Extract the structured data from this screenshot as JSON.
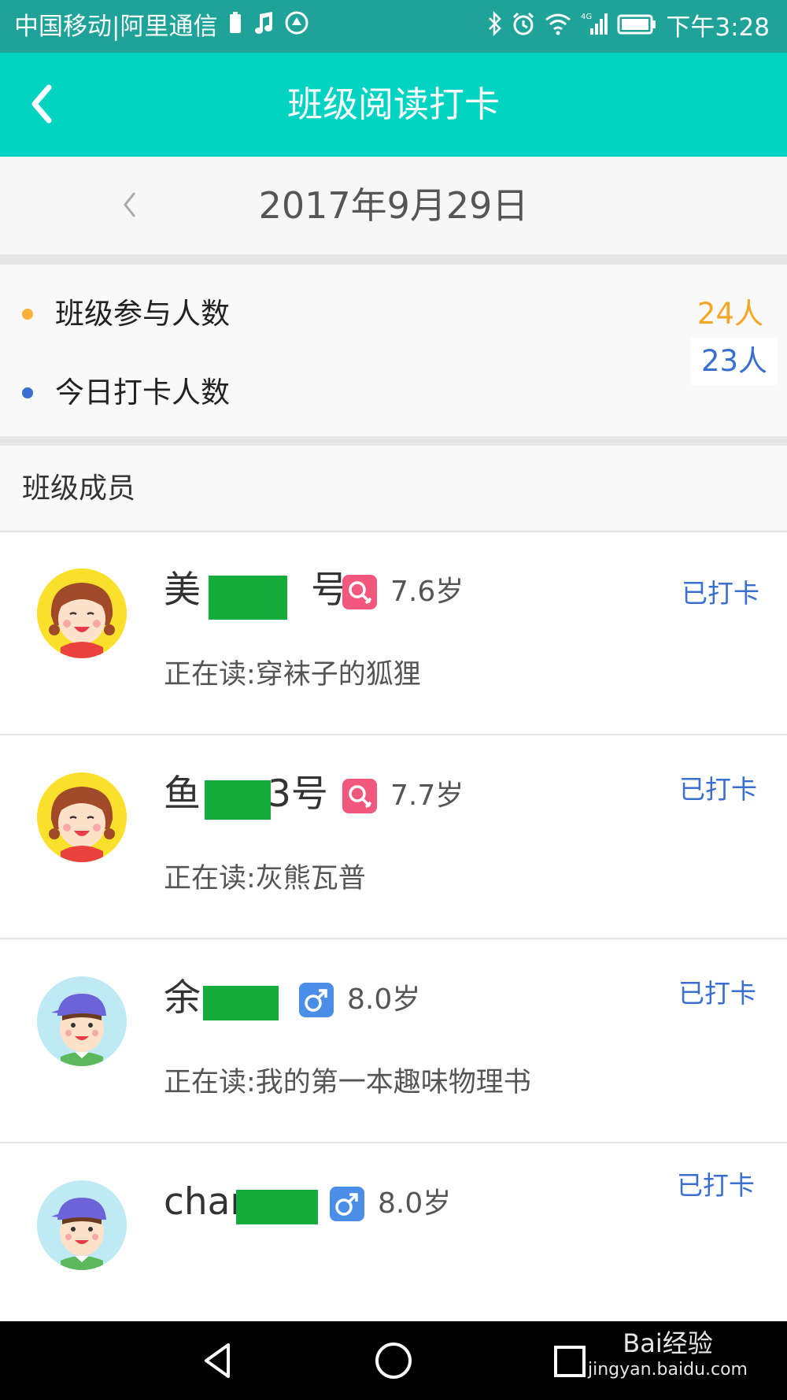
{
  "status_bar": {
    "carrier": "中国移动|阿里通信",
    "time": "下午3:28",
    "icons_left": [
      "battery-saver-icon",
      "music-note-icon",
      "app-notification-icon"
    ],
    "icons_right": [
      "bluetooth-icon",
      "alarm-icon",
      "wifi-icon",
      "signal-4g-icon",
      "battery-icon"
    ]
  },
  "header": {
    "title": "班级阅读打卡",
    "back_icon": "chevron-left-icon",
    "bg_color": "#00d3c2"
  },
  "date_bar": {
    "date": "2017年9月29日",
    "prev_icon": "chevron-left-icon"
  },
  "stats": [
    {
      "label": "班级参与人数",
      "value": "24人",
      "dot_color": "#f7b03c",
      "value_color": "#f5a623"
    },
    {
      "label": "今日打卡人数",
      "value": "23人",
      "dot_color": "#3a6fd1",
      "value_color": "#3a6fd1"
    }
  ],
  "members_section": {
    "title": "班级成员"
  },
  "members": [
    {
      "name_prefix": "美",
      "name_suffix": "号",
      "gender": "female",
      "gender_icon": "female-icon",
      "age": "7.6岁",
      "status": "已打卡",
      "reading": "正在读:穿袜子的狐狸",
      "avatar": "girl-avatar-icon"
    },
    {
      "name_prefix": "鱼",
      "name_suffix": "3号",
      "gender": "female",
      "gender_icon": "female-icon",
      "age": "7.7岁",
      "status": "已打卡",
      "reading": "正在读:灰熊瓦普",
      "avatar": "girl-avatar-icon"
    },
    {
      "name_prefix": "余",
      "name_suffix": "",
      "gender": "male",
      "gender_icon": "male-icon",
      "age": "8.0岁",
      "status": "已打卡",
      "reading": "正在读:我的第一本趣味物理书",
      "avatar": "boy-avatar-icon"
    },
    {
      "name_prefix": "char",
      "name_suffix": "",
      "gender": "male",
      "gender_icon": "male-icon",
      "age": "8.0岁",
      "status": "已打卡",
      "reading": "",
      "avatar": "boy-avatar-icon"
    }
  ],
  "nav_bar": {
    "back_icon": "triangle-back-icon",
    "home_icon": "circle-home-icon",
    "recents_icon": "square-recents-icon"
  },
  "watermark": {
    "logo": "Bai经验",
    "url": "jingyan.baidu.com"
  },
  "colors": {
    "female_badge": "#f2577d",
    "male_badge": "#4a8ee8",
    "checkin_text": "#3a6fd1",
    "redaction": "#14ad3c"
  }
}
